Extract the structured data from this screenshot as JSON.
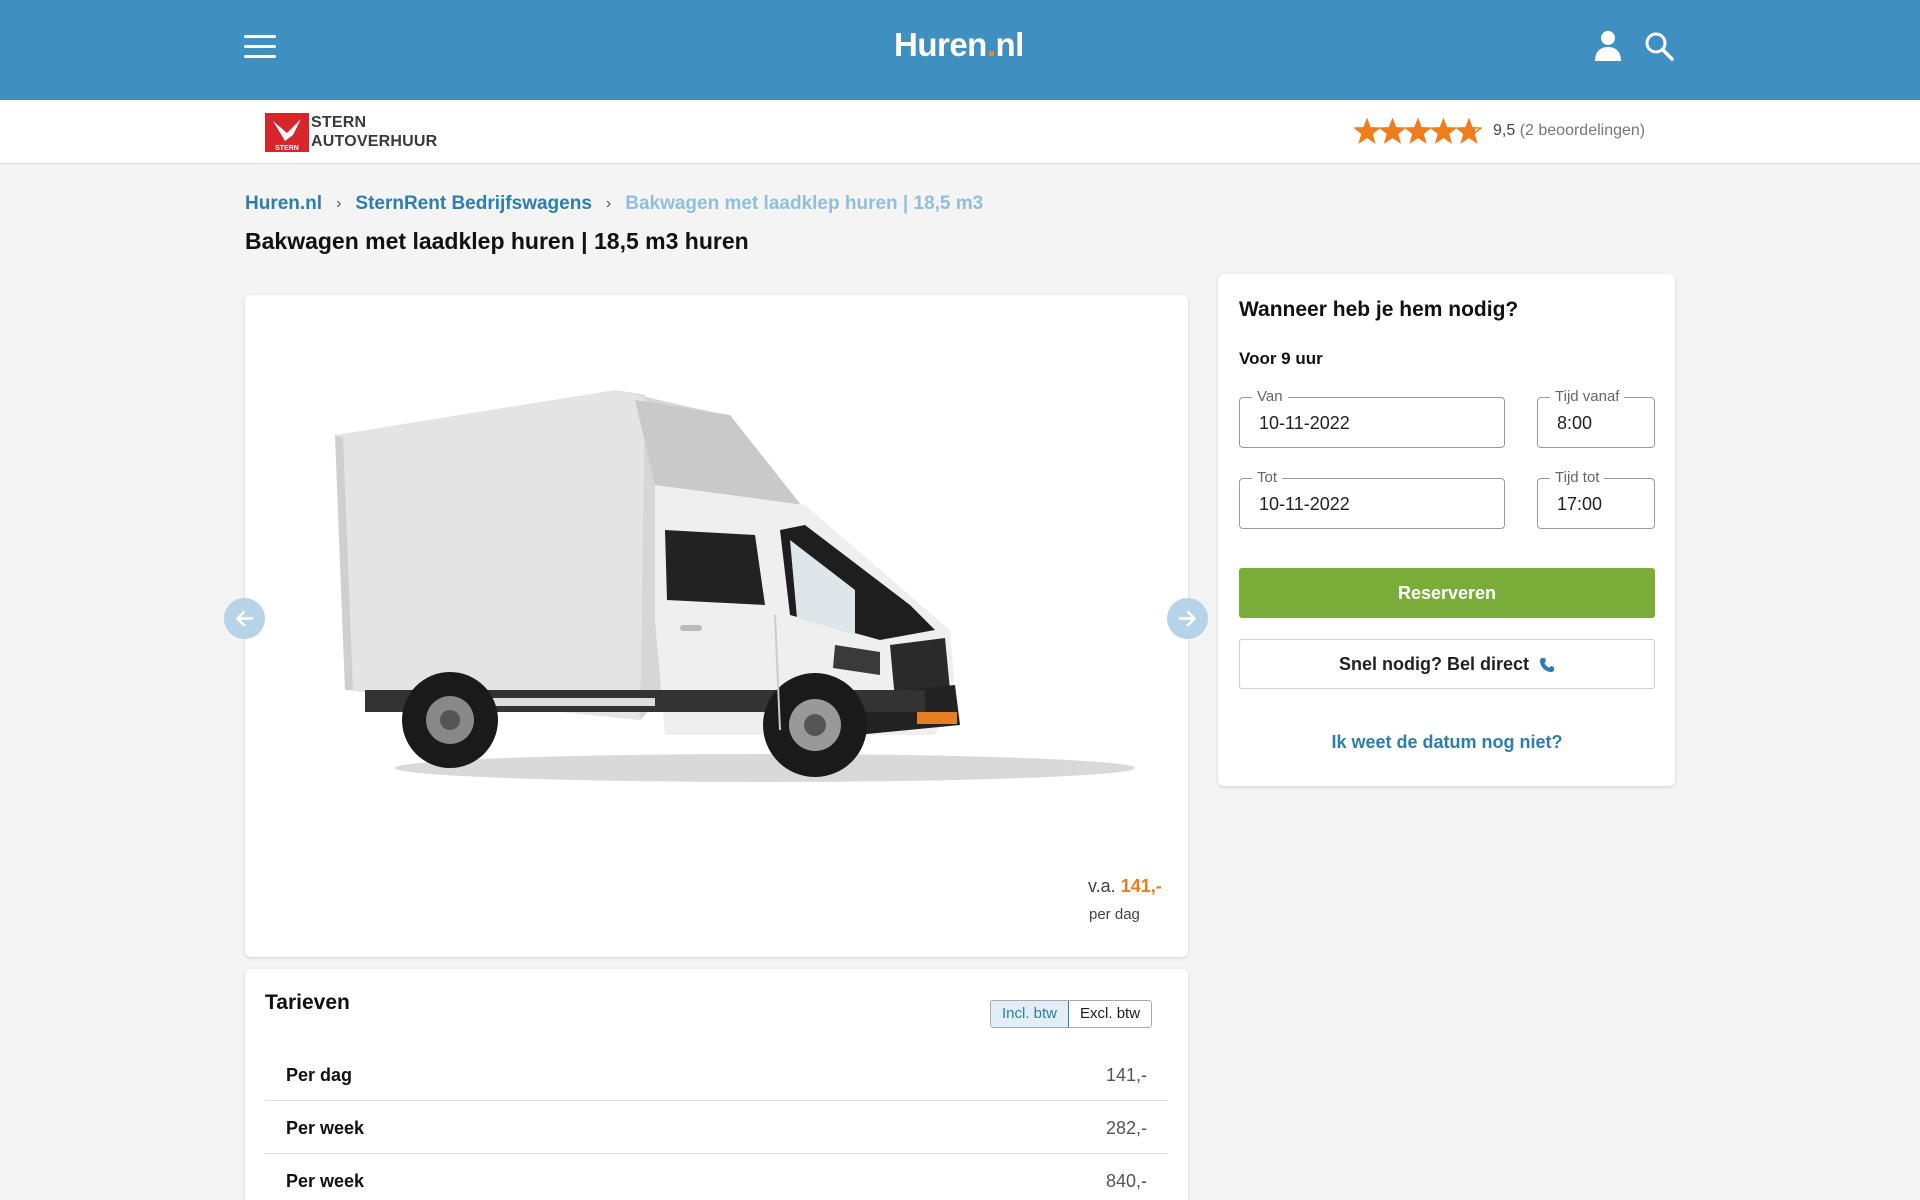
{
  "header": {
    "logo_main": "Huren",
    "logo_dot": ".",
    "logo_tld": "nl",
    "menu_icon": "hamburger-menu-icon",
    "account_icon": "user-icon",
    "search_icon": "search-icon",
    "brand_color": "#3f8fc0"
  },
  "vendor": {
    "name_line1": "STERN",
    "name_line2": "AUTOVERHUUR",
    "logo_text": "STERN",
    "rating_stars": 4.75,
    "rating_max": 5,
    "rating_score": "9,5",
    "rating_count": "(2 beoordelingen)"
  },
  "breadcrumb": {
    "items": [
      "Huren.nl",
      "SternRent Bedrijfswagens",
      "Bakwagen met laadklep huren | 18,5 m3"
    ]
  },
  "page": {
    "title": "Bakwagen met laadklep huren | 18,5 m3 huren"
  },
  "gallery": {
    "prev_icon": "arrow-left-icon",
    "next_icon": "arrow-right-icon",
    "price_prefix": "v.a.",
    "price_value": "141,-",
    "price_unit": "per dag"
  },
  "booking": {
    "title": "Wanneer heb je hem nodig?",
    "duration": "Voor 9 uur",
    "from_label": "Van",
    "from_value": "10-11-2022",
    "time_from_label": "Tijd vanaf",
    "time_from_value": "8:00",
    "to_label": "Tot",
    "to_value": "10-11-2022",
    "time_to_label": "Tijd tot",
    "time_to_value": "17:00",
    "reserve_label": "Reserveren",
    "call_label": "Snel nodig? Bel direct",
    "call_icon": "phone-icon",
    "unknown_date_label": "Ik weet de datum nog niet?",
    "reserve_color": "#7aad37"
  },
  "rates": {
    "title": "Tarieven",
    "toggle_incl": "Incl. btw",
    "toggle_excl": "Excl. btw",
    "rows": [
      {
        "label": "Per dag",
        "value": "141,-"
      },
      {
        "label": "Per week",
        "value": "282,-"
      },
      {
        "label": "Per week",
        "value": "840,-"
      }
    ]
  }
}
